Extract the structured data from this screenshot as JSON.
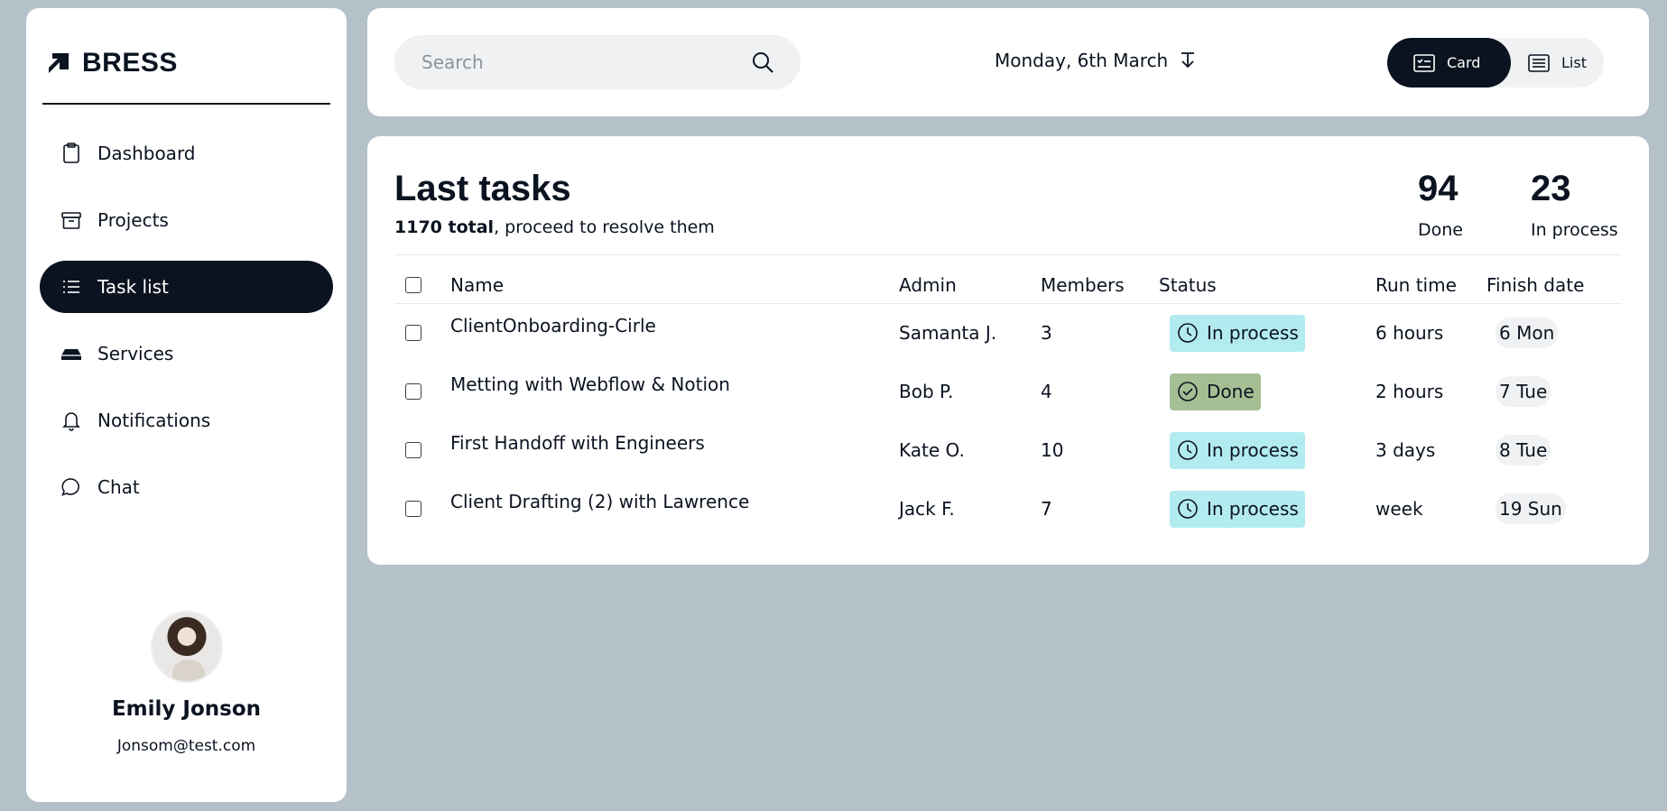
{
  "brand": {
    "name": "BRESS",
    "icon": "bress-logo-icon"
  },
  "sidebar": {
    "items": [
      {
        "label": "Dashboard",
        "icon": "clipboard-icon",
        "active": false
      },
      {
        "label": "Projects",
        "icon": "archive-box-icon",
        "active": false
      },
      {
        "label": "Task list",
        "icon": "list-icon",
        "active": true
      },
      {
        "label": "Services",
        "icon": "drive-icon",
        "active": false
      },
      {
        "label": "Notifications",
        "icon": "bell-icon",
        "active": false
      },
      {
        "label": "Chat",
        "icon": "chat-bubble-icon",
        "active": false
      }
    ]
  },
  "profile": {
    "name": "Emily Jonson",
    "email": "Jonsom@test.com"
  },
  "topbar": {
    "search_placeholder": "Search",
    "date_label": "Monday, 6th March",
    "view_card_label": "Card",
    "view_list_label": "List",
    "active_view": "Card"
  },
  "tasks": {
    "title": "Last tasks",
    "total_bold": "1170 total",
    "total_rest": ", proceed to resolve them",
    "stats": {
      "done_value": "94",
      "done_label": "Done",
      "process_value": "23",
      "process_label": "In process"
    },
    "columns": {
      "name": "Name",
      "admin": "Admin",
      "members": "Members",
      "status": "Status",
      "run_time": "Run time",
      "finish_date": "Finish date"
    },
    "rows": [
      {
        "name": "ClientOnboarding-Cirle",
        "admin": "Samanta J.",
        "members": "3",
        "status": "In process",
        "run_time": "6 hours",
        "finish_date": "6 Mon"
      },
      {
        "name": "Metting with Webflow & Notion",
        "admin": "Bob P.",
        "members": "4",
        "status": "Done",
        "run_time": "2 hours",
        "finish_date": "7 Tue"
      },
      {
        "name": "First Handoff with Engineers",
        "admin": "Kate O.",
        "members": "10",
        "status": "In process",
        "run_time": "3 days",
        "finish_date": "8 Tue"
      },
      {
        "name": "Client Drafting (2) with Lawrence",
        "admin": "Jack F.",
        "members": "7",
        "status": "In process",
        "run_time": "week",
        "finish_date": "19 Sun"
      }
    ]
  },
  "colors": {
    "primary": "#0b1320",
    "background": "#b4c1c9",
    "in_process": "#b2ebf0",
    "done": "#a5bf94"
  }
}
